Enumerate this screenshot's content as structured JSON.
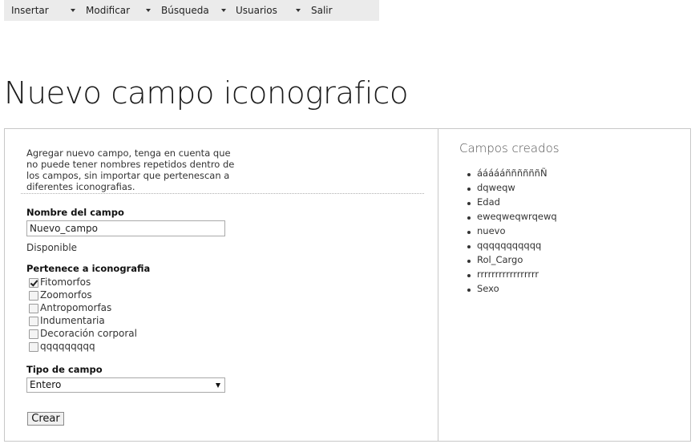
{
  "menu": {
    "items": [
      {
        "label": "Insertar"
      },
      {
        "label": "Modificar"
      },
      {
        "label": "Búsqueda"
      },
      {
        "label": "Usuarios"
      },
      {
        "label": "Salir"
      }
    ]
  },
  "page": {
    "title": "Nuevo campo iconografico"
  },
  "form": {
    "intro_lines": [
      "Agregar nuevo campo, tenga en cuenta que",
      "no puede tener nombres repetidos dentro de",
      "los campos, sin importar que pertenescan a",
      "diferentes iconografias."
    ],
    "name_label": "Nombre del campo",
    "name_value": "Nuevo_campo",
    "availability": "Disponible",
    "iconography_label": "Pertenece a iconografia",
    "iconographies": [
      {
        "label": "Fitomorfos",
        "checked": true
      },
      {
        "label": "Zoomorfos",
        "checked": false
      },
      {
        "label": "Antropomorfas",
        "checked": false
      },
      {
        "label": "Indumentaria",
        "checked": false
      },
      {
        "label": "Decoración corporal",
        "checked": false
      },
      {
        "label": "qqqqqqqqq",
        "checked": false
      }
    ],
    "type_label": "Tipo de campo",
    "type_selected": "Entero",
    "submit_label": "Crear"
  },
  "created_fields": {
    "title": "Campos creados",
    "items": [
      "áááááññññññÑ",
      "dqweqw",
      "Edad",
      "eweqweqwrqewq",
      "nuevo",
      "qqqqqqqqqqq",
      "Rol_Cargo",
      "rrrrrrrrrrrrrrrrr",
      "Sexo"
    ]
  }
}
